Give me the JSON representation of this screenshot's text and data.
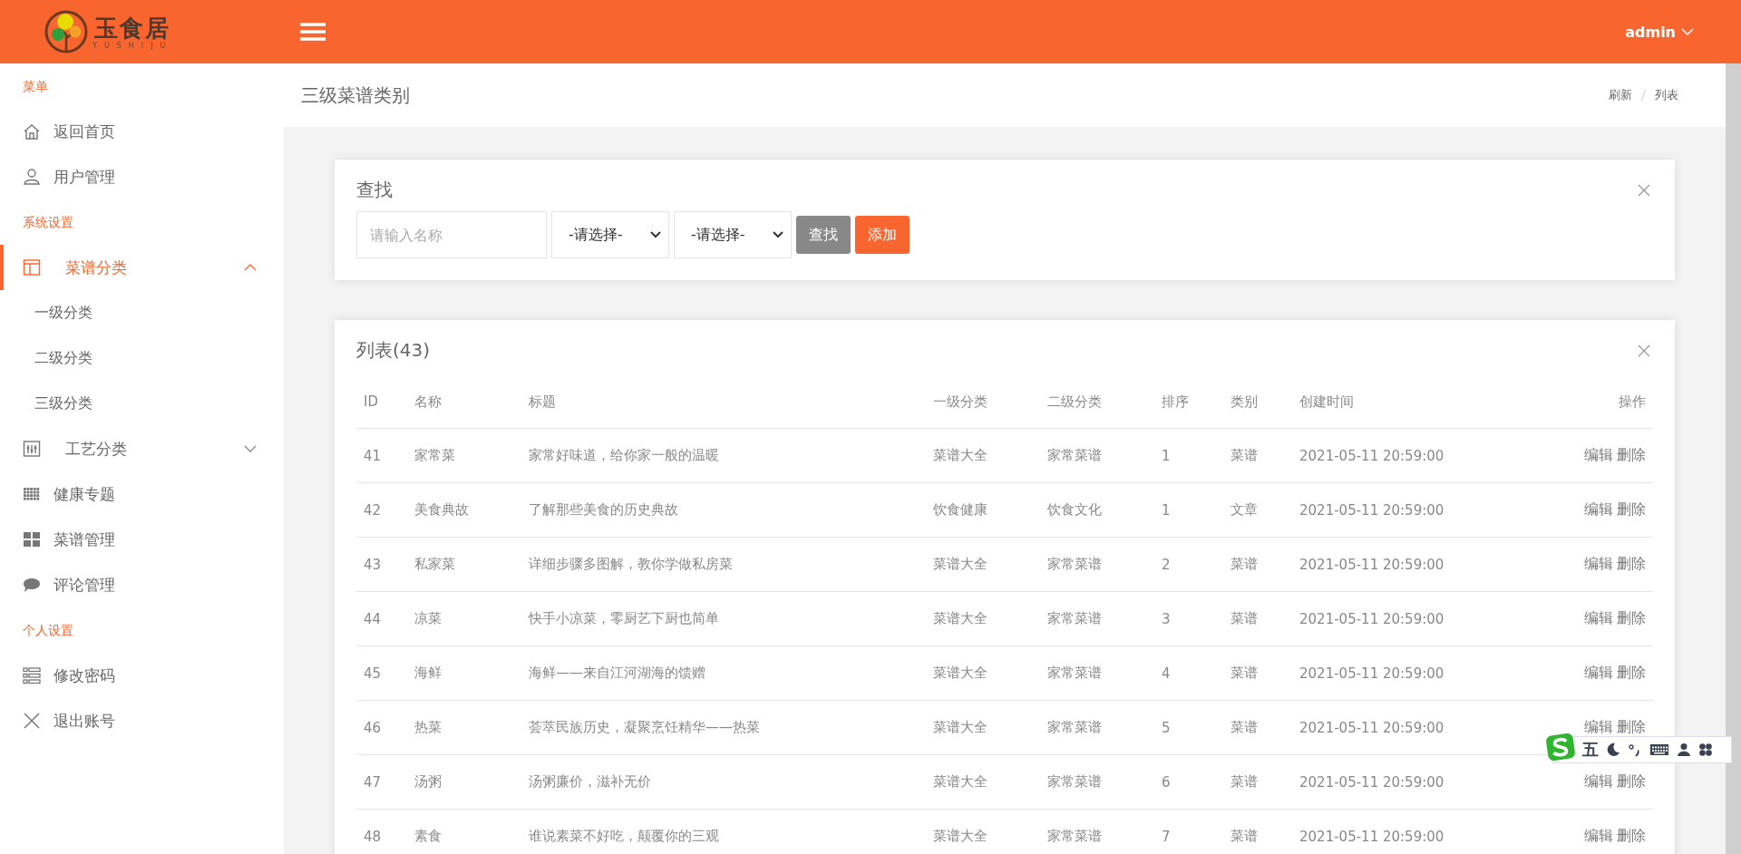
{
  "header": {
    "logo_text": "玉食居",
    "logo_subtitle": "YUSHIJU",
    "user": "admin"
  },
  "sidebar": [
    {
      "kind": "heading",
      "label": "菜单"
    },
    {
      "kind": "item",
      "label": "返回首页",
      "selected": false
    },
    {
      "kind": "item",
      "label": "用户管理",
      "selected": false
    },
    {
      "kind": "heading",
      "label": "系统设置"
    },
    {
      "kind": "group",
      "label": "菜谱分类",
      "selected": true,
      "expanded": true,
      "children": [
        {
          "label": "一级分类",
          "selected": false
        },
        {
          "label": "二级分类",
          "selected": false
        },
        {
          "label": "三级分类",
          "selected": false
        }
      ]
    },
    {
      "kind": "group",
      "label": "工艺分类",
      "selected": false,
      "expanded": false
    },
    {
      "kind": "item",
      "label": "健康专题",
      "selected": false
    },
    {
      "kind": "item",
      "label": "菜谱管理",
      "selected": false
    },
    {
      "kind": "item",
      "label": "评论管理",
      "selected": false
    },
    {
      "kind": "heading",
      "label": "个人设置"
    },
    {
      "kind": "item",
      "label": "修改密码",
      "selected": false
    },
    {
      "kind": "item",
      "label": "退出账号",
      "selected": false
    }
  ],
  "page": {
    "title": "三级菜谱类别",
    "breadcrumb": [
      "刷新",
      "列表"
    ]
  },
  "search_card": {
    "title": "查找",
    "placeholder": "请输入名称",
    "selects": [
      "-请选择-",
      "-请选择-"
    ],
    "buttons": [
      {
        "kind": "secondary",
        "label": "查找"
      },
      {
        "kind": "primary",
        "label": "添加"
      }
    ]
  },
  "table": {
    "title": "列表(43)",
    "columns": [
      "ID",
      "名称",
      "标题",
      "一级分类",
      "二级分类",
      "排序",
      "类别",
      "创建时间",
      "操作"
    ],
    "rows": [
      {
        "id": "41",
        "name": "家常菜",
        "title": "家常好味道，给你家一般的温暖",
        "cat1": "菜谱大全",
        "cat2": "家常菜谱",
        "order": "1",
        "type": "菜谱",
        "created": "2021-05-11 20:59:00",
        "actions": [
          "编辑",
          "删除"
        ]
      },
      {
        "id": "42",
        "name": "美食典故",
        "title": "了解那些美食的历史典故",
        "cat1": "饮食健康",
        "cat2": "饮食文化",
        "order": "1",
        "type": "文章",
        "created": "2021-05-11 20:59:00",
        "actions": [
          "编辑",
          "删除"
        ]
      },
      {
        "id": "43",
        "name": "私家菜",
        "title": "详细步骤多图解，教你学做私房菜",
        "cat1": "菜谱大全",
        "cat2": "家常菜谱",
        "order": "2",
        "type": "菜谱",
        "created": "2021-05-11 20:59:00",
        "actions": [
          "编辑",
          "删除"
        ]
      },
      {
        "id": "44",
        "name": "凉菜",
        "title": "快手小凉菜，零厨艺下厨也简单",
        "cat1": "菜谱大全",
        "cat2": "家常菜谱",
        "order": "3",
        "type": "菜谱",
        "created": "2021-05-11 20:59:00",
        "actions": [
          "编辑",
          "删除"
        ]
      },
      {
        "id": "45",
        "name": "海鲜",
        "title": "海鲜——来自江河湖海的馈赠",
        "cat1": "菜谱大全",
        "cat2": "家常菜谱",
        "order": "4",
        "type": "菜谱",
        "created": "2021-05-11 20:59:00",
        "actions": [
          "编辑",
          "删除"
        ]
      },
      {
        "id": "46",
        "name": "热菜",
        "title": "荟萃民族历史，凝聚烹饪精华——热菜",
        "cat1": "菜谱大全",
        "cat2": "家常菜谱",
        "order": "5",
        "type": "菜谱",
        "created": "2021-05-11 20:59:00",
        "actions": [
          "编辑",
          "删除"
        ]
      },
      {
        "id": "47",
        "name": "汤粥",
        "title": "汤粥廉价，滋补无价",
        "cat1": "菜谱大全",
        "cat2": "家常菜谱",
        "order": "6",
        "type": "菜谱",
        "created": "2021-05-11 20:59:00",
        "actions": [
          "编辑",
          "删除"
        ]
      },
      {
        "id": "48",
        "name": "素食",
        "title": "谁说素菜不好吃，颠覆你的三观",
        "cat1": "菜谱大全",
        "cat2": "家常菜谱",
        "order": "7",
        "type": "菜谱",
        "created": "2021-05-11 20:59:00",
        "actions": [
          "编辑",
          "删除"
        ]
      }
    ]
  },
  "ime_toolbar": {
    "mode": "五"
  }
}
